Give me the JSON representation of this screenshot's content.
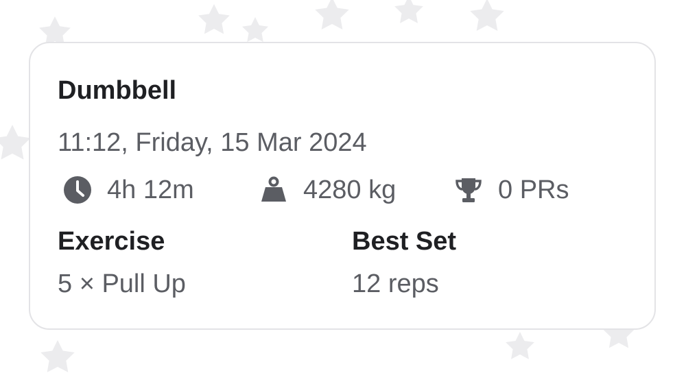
{
  "workout": {
    "title": "Dumbbell",
    "datetime": "11:12, Friday, 15 Mar 2024"
  },
  "stats": {
    "duration": "4h 12m",
    "volume": "4280 kg",
    "prs": "0 PRs"
  },
  "icons": {
    "duration": "clock-icon",
    "volume": "weight-icon",
    "prs": "trophy-icon"
  },
  "table": {
    "headers": {
      "exercise": "Exercise",
      "best_set": "Best Set"
    },
    "rows": [
      {
        "exercise": "5 × Pull Up",
        "best_set": "12 reps"
      }
    ]
  },
  "colors": {
    "icon": "#5b5d63",
    "heading": "#1f2023",
    "text": "#5b5d63",
    "card_border": "#e3e3e6"
  }
}
